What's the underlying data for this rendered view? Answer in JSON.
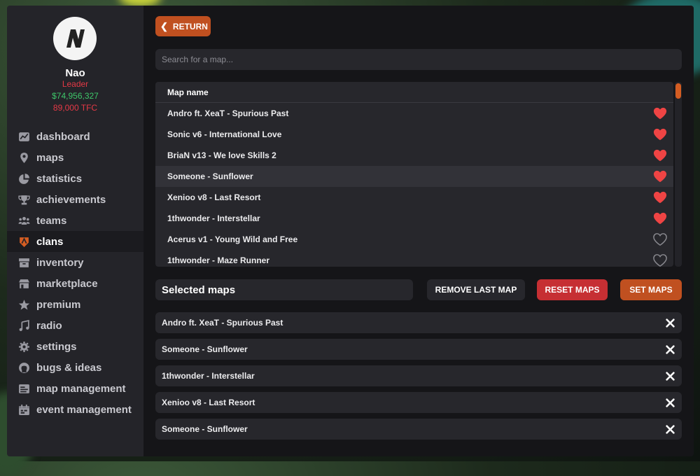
{
  "user": {
    "name": "Nao",
    "role": "Leader",
    "money": "$74,956,327",
    "tfc": "89,000 TFC",
    "avatar_icon": "n-logo-icon"
  },
  "nav": [
    {
      "label": "dashboard",
      "icon": "dashboard-icon",
      "active": false
    },
    {
      "label": "maps",
      "icon": "map-pin-icon",
      "active": false
    },
    {
      "label": "statistics",
      "icon": "pie-chart-icon",
      "active": false
    },
    {
      "label": "achievements",
      "icon": "trophy-icon",
      "active": false
    },
    {
      "label": "teams",
      "icon": "users-icon",
      "active": false
    },
    {
      "label": "clans",
      "icon": "shield-icon",
      "active": true
    },
    {
      "label": "inventory",
      "icon": "inventory-icon",
      "active": false
    },
    {
      "label": "marketplace",
      "icon": "store-icon",
      "active": false
    },
    {
      "label": "premium",
      "icon": "star-icon",
      "active": false
    },
    {
      "label": "radio",
      "icon": "music-icon",
      "active": false
    },
    {
      "label": "settings",
      "icon": "gear-icon",
      "active": false
    },
    {
      "label": "bugs & ideas",
      "icon": "github-icon",
      "active": false
    },
    {
      "label": "map management",
      "icon": "map-management-icon",
      "active": false
    },
    {
      "label": "event management",
      "icon": "calendar-icon",
      "active": false
    }
  ],
  "return_label": "RETURN",
  "search": {
    "placeholder": "Search for a map...",
    "value": ""
  },
  "map_table": {
    "header": "Map name",
    "rows": [
      {
        "name": "Andro ft. XeaT - Spurious Past",
        "favorite": true
      },
      {
        "name": "Sonic v6 - International Love",
        "favorite": true
      },
      {
        "name": "BriaN v13 - We love Skills 2",
        "favorite": true
      },
      {
        "name": "Someone - Sunflower",
        "favorite": true
      },
      {
        "name": "Xenioo v8 - Last Resort",
        "favorite": true
      },
      {
        "name": "1thwonder - Interstellar",
        "favorite": true
      },
      {
        "name": "Acerus v1 - Young Wild and Free",
        "favorite": false
      },
      {
        "name": "1thwonder - Maze Runner",
        "favorite": false
      }
    ],
    "highlighted_row": 3
  },
  "selected_title": "Selected maps",
  "buttons": {
    "remove_last": "REMOVE LAST MAP",
    "reset": "RESET MAPS",
    "set": "SET MAPS"
  },
  "selected_maps": [
    "Andro ft. XeaT - Spurious Past",
    "Someone - Sunflower",
    "1thwonder - Interstellar",
    "Xenioo v8 - Last Resort",
    "Someone - Sunflower"
  ],
  "colors": {
    "accent": "#c05020",
    "danger": "#c62f33",
    "heart": "#ef4444",
    "money": "#3ec76a",
    "role": "#e53946"
  }
}
